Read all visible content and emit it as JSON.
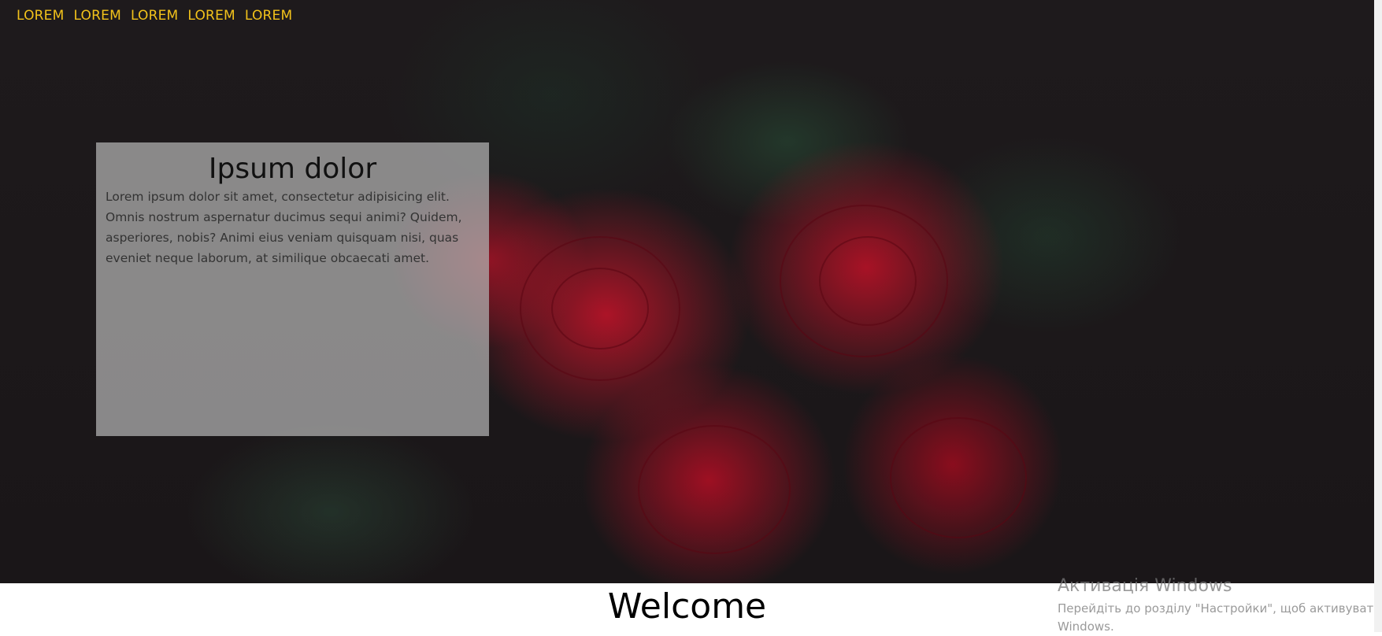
{
  "nav": {
    "items": [
      "LOREM",
      "LOREM",
      "LOREM",
      "LOREM",
      "LOREM"
    ]
  },
  "hero": {
    "image": "red-roses-photo"
  },
  "card": {
    "title": "Ipsum dolor",
    "body": "Lorem ipsum dolor sit amet, consectetur adipisicing elit. Omnis nostrum aspernatur ducimus sequi animi? Quidem, asperiores, nobis? Animi eius veniam quisquam nisi, quas eveniet neque laborum, at similique obcaecati amet."
  },
  "welcome": {
    "heading": "Welcome"
  },
  "windows_activation": {
    "title": "Активація Windows",
    "line1": "Перейдіть до розділу \"Настройки\", щоб активуват",
    "line2": "Windows."
  },
  "colors": {
    "nav_link": "#f2c21b",
    "card_bg": "rgba(175,175,175,0.75)",
    "background": "#1e1a1c"
  }
}
